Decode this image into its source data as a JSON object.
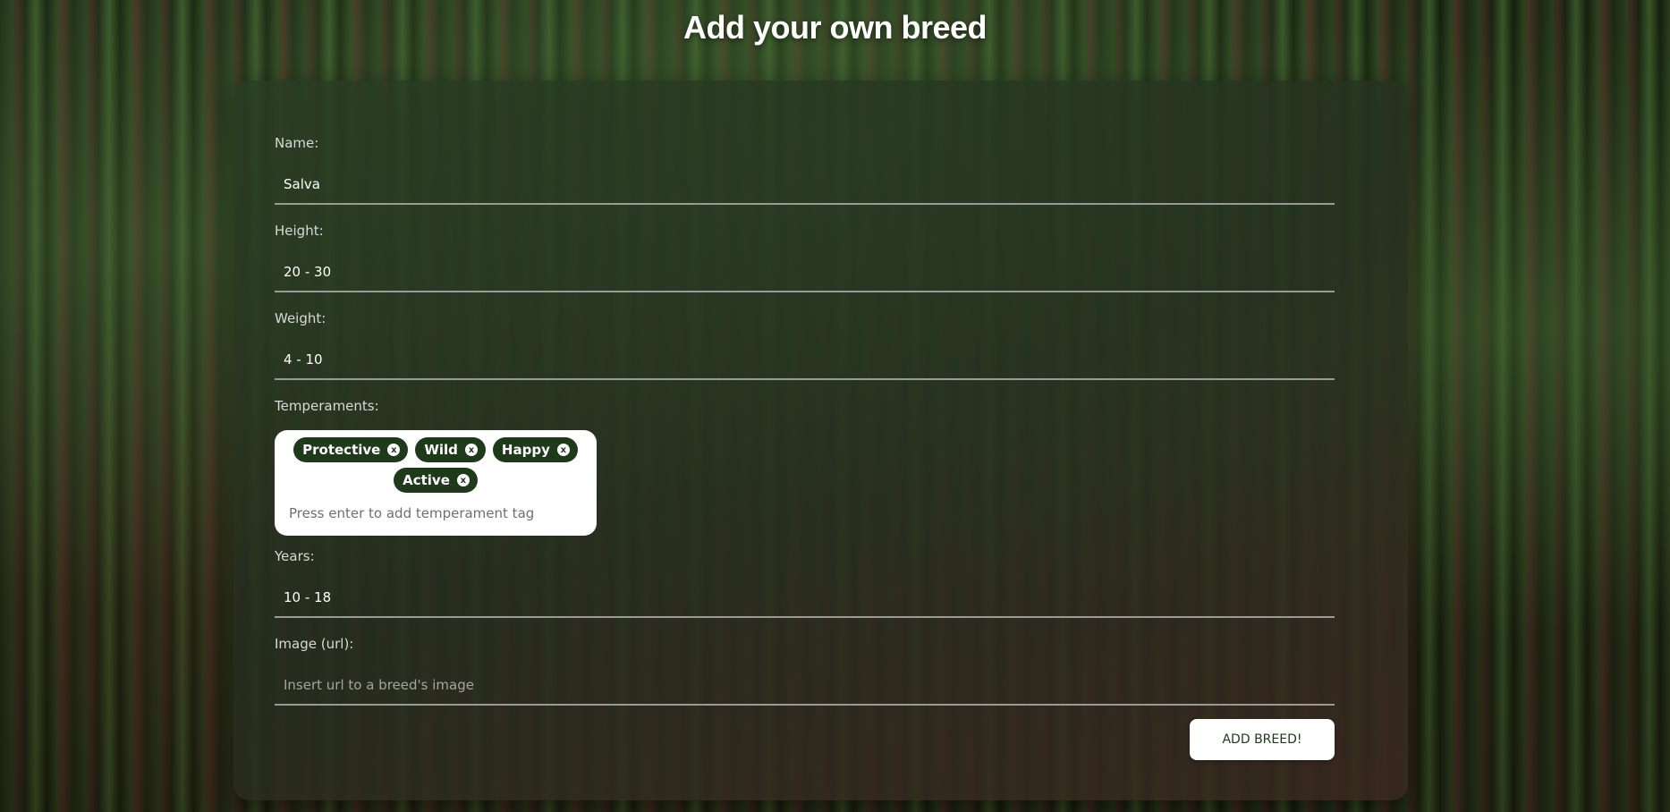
{
  "page": {
    "title": "Add your own breed"
  },
  "form": {
    "name": {
      "label": "Name:",
      "value": "Salva"
    },
    "height": {
      "label": "Height:",
      "value": "20 - 30"
    },
    "weight": {
      "label": "Weight:",
      "value": "4 - 10"
    },
    "temperaments": {
      "label": "Temperaments:",
      "tags": [
        "Protective",
        "Wild",
        "Happy",
        "Active"
      ],
      "remove_glyph": "x",
      "placeholder": "Press enter to add temperament tag"
    },
    "years": {
      "label": "Years:",
      "value": "10 - 18"
    },
    "image": {
      "label": "Image (url):",
      "value": "",
      "placeholder": "Insert url to a breed's image"
    },
    "submit_label": "ADD BREED!"
  },
  "colors": {
    "tag_bg": "#1e3a1a",
    "button_bg": "#ffffff",
    "button_text": "#1e3a1a"
  }
}
